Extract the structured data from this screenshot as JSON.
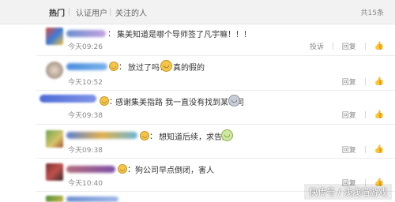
{
  "tabs": [
    "热门",
    "认证用户",
    "关注的人"
  ],
  "total": "共15条",
  "actions": {
    "report": "投诉",
    "reply": "回复",
    "thumb": "👍"
  },
  "comments": [
    {
      "colon": "：",
      "text": "集美知道是哪个导师签了凡宇嘛！！！",
      "time": "今天09:26",
      "report": "投诉"
    },
    {
      "colon": "：",
      "text1": "放过了吗?",
      "text2": "真的假的",
      "time": "今天10:52"
    },
    {
      "colon": "：",
      "text": "感谢集美指路 我一直没有找到某公司",
      "time": "今天09:38"
    },
    {
      "colon": "：",
      "text": "想知道后续，求告知",
      "time": "今天09:38"
    },
    {
      "colon": "：",
      "text": "狗公司早点倒闭，害人",
      "time": "今天10:40"
    }
  ],
  "watermark": "快传号 / 浅浅喵游戏",
  "colors": {
    "tabbar": "#f2f2f2",
    "text": "#333333",
    "meta": "#8a8a8a",
    "emote": "#f5c54a"
  },
  "icons": [
    "smile-emote-icon",
    "grin-emote-icon",
    "thumbs-up-icon",
    "blushing-emote-icon"
  ]
}
